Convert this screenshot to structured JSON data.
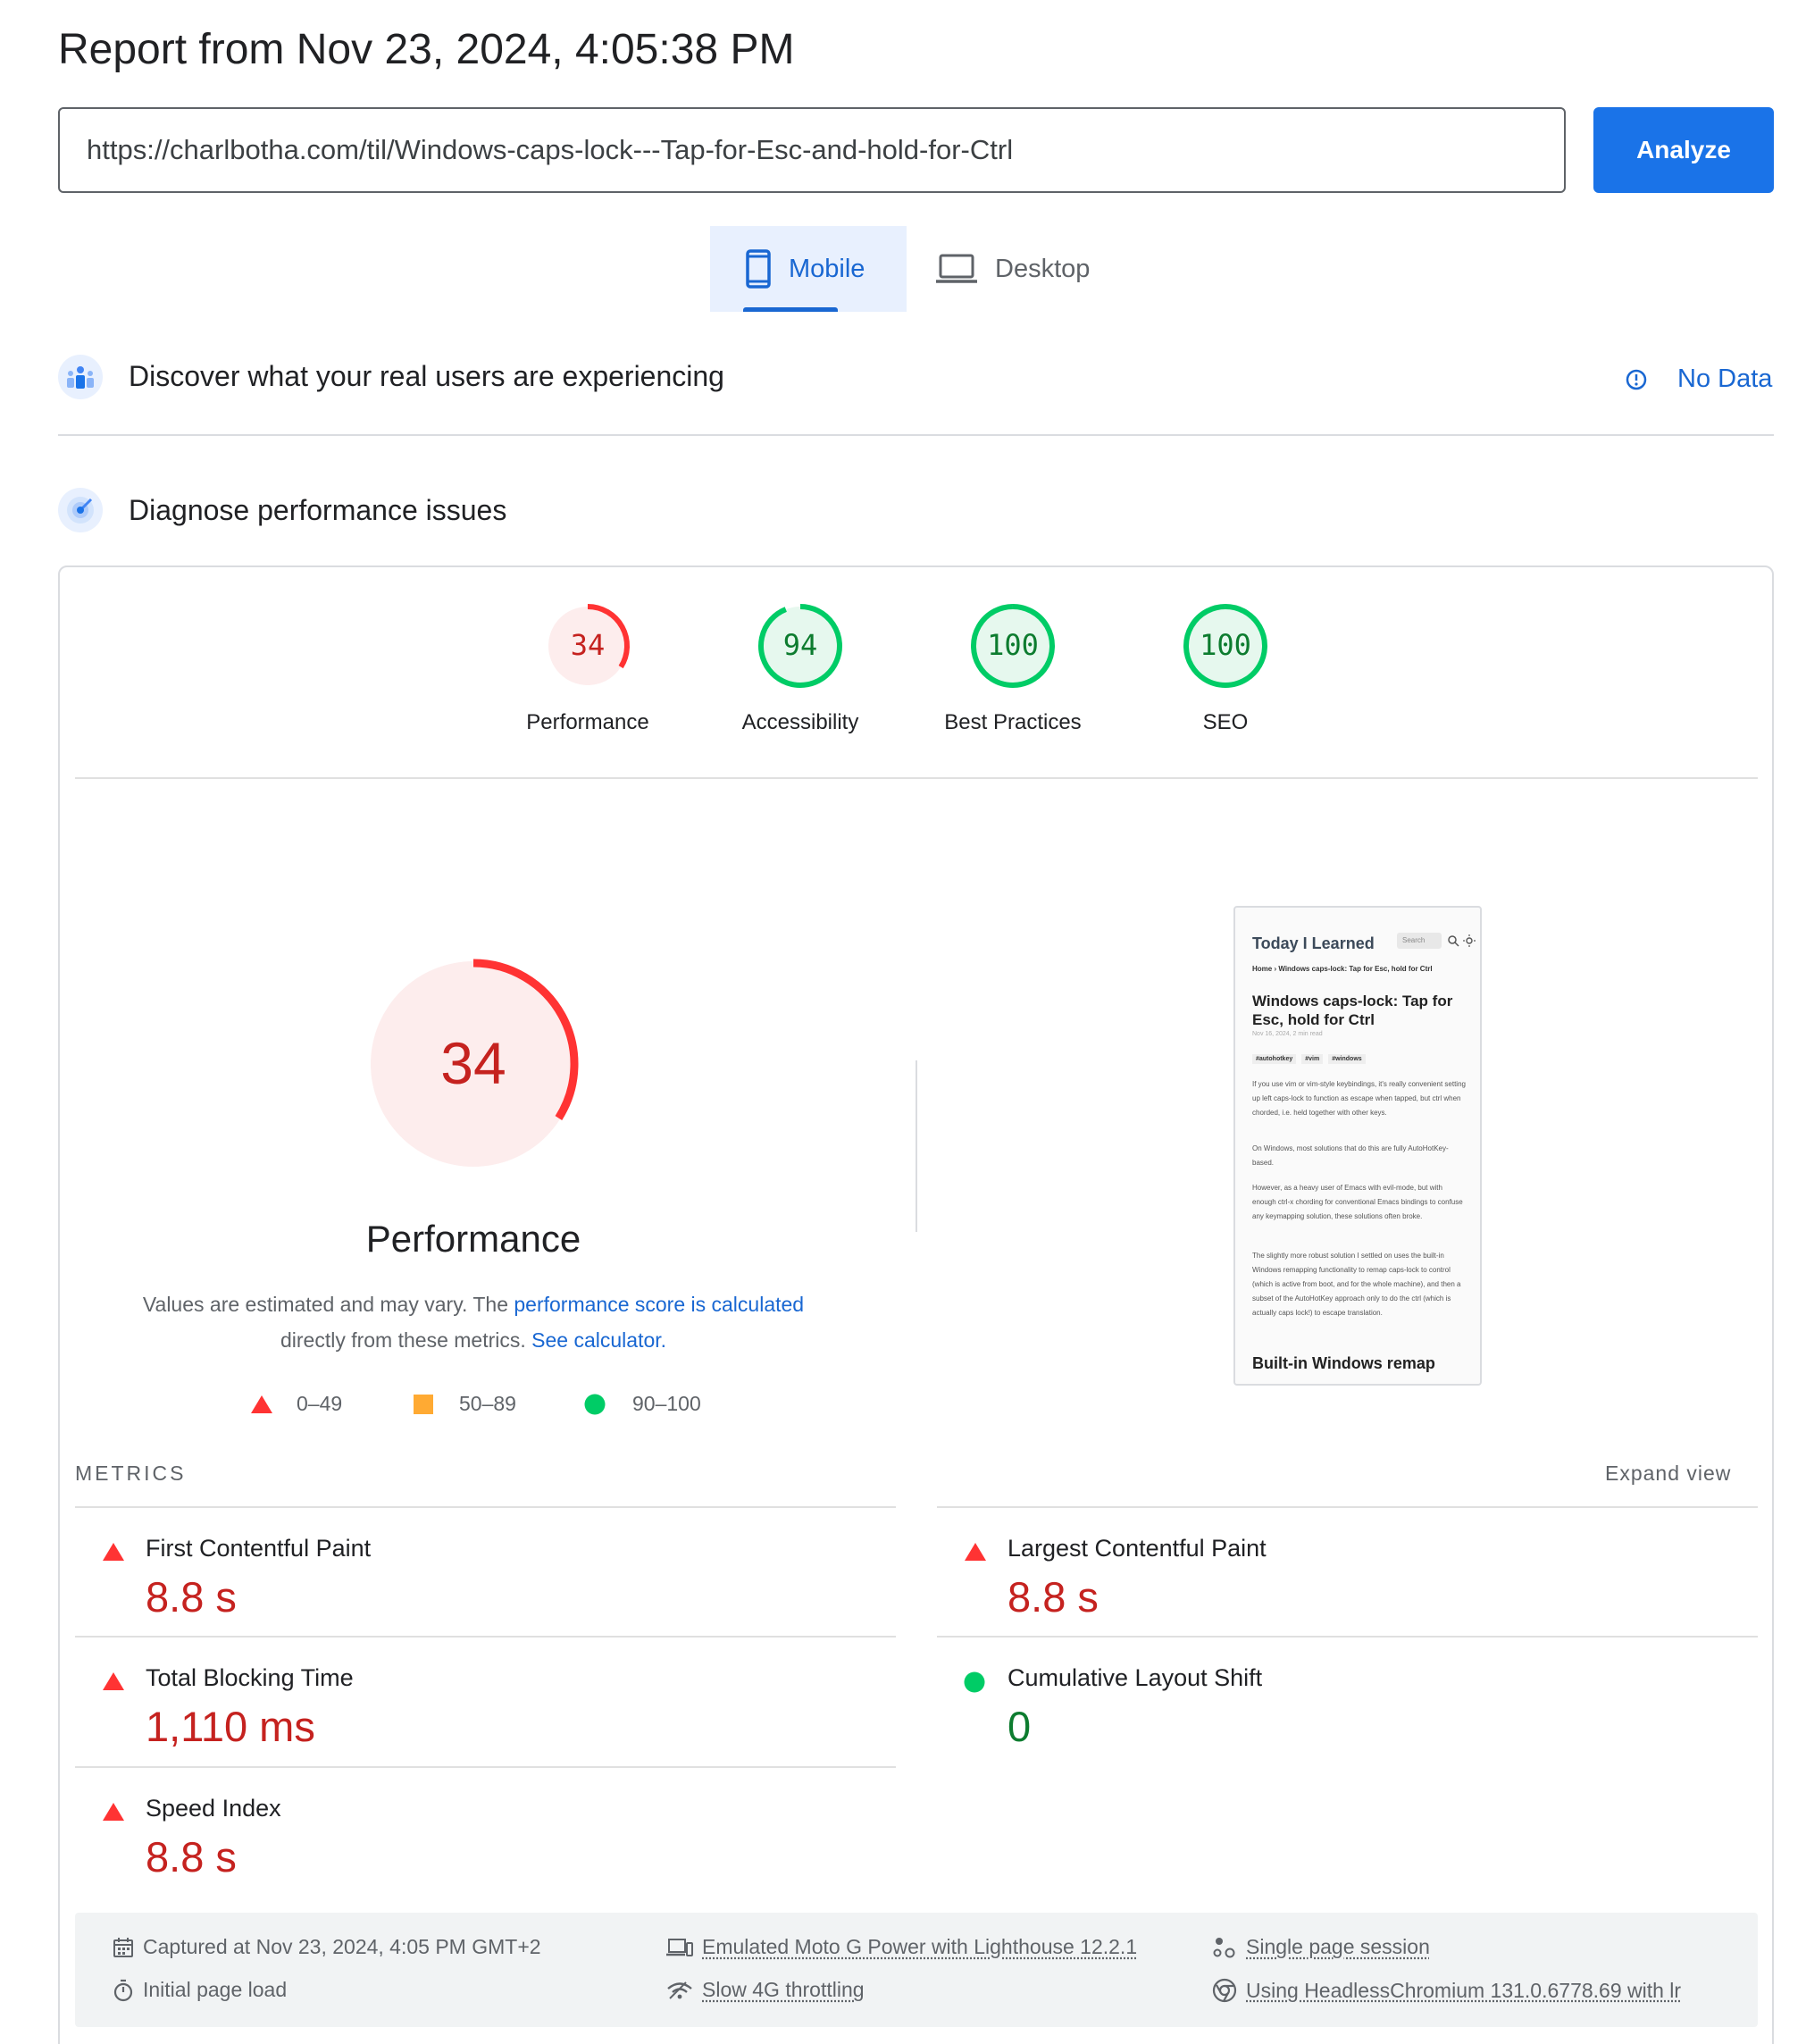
{
  "page": {
    "title": "Report from Nov 23, 2024, 4:05:38 PM"
  },
  "search": {
    "url": "https://charlbotha.com/til/Windows-caps-lock---Tap-for-Esc-and-hold-for-Ctrl",
    "analyze_label": "Analyze"
  },
  "tabs": [
    {
      "label": "Mobile",
      "active": true,
      "icon": "smartphone-icon"
    },
    {
      "label": "Desktop",
      "active": false,
      "icon": "laptop-icon"
    }
  ],
  "field_data": {
    "heading": "Discover what your real users are experiencing",
    "status": "No Data",
    "icon": "crux-users-icon"
  },
  "lab_data": {
    "heading": "Diagnose performance issues",
    "icon": "lighthouse-radar-icon"
  },
  "scores": [
    {
      "label": "Performance",
      "score": 34,
      "color": "#c5221f",
      "bg": "#fdeded",
      "arc": "#f33"
    },
    {
      "label": "Accessibility",
      "score": 94,
      "color": "#0d7c2f",
      "bg": "#e6f8ee",
      "arc": "#0c6"
    },
    {
      "label": "Best Practices",
      "score": 100,
      "color": "#0d7c2f",
      "bg": "#e6f8ee",
      "arc": "#0c6"
    },
    {
      "label": "SEO",
      "score": 100,
      "color": "#0d7c2f",
      "bg": "#e6f8ee",
      "arc": "#0c6"
    }
  ],
  "performance": {
    "score": 34,
    "title": "Performance",
    "desc_prefix": "Values are estimated and may vary. The ",
    "desc_link": "performance score is calculated",
    "desc_middle": "directly from these metrics. ",
    "desc_link2": "See calculator."
  },
  "legend": [
    {
      "label": "0–49",
      "shape": "triangle",
      "color": "#f33"
    },
    {
      "label": "50–89",
      "shape": "square",
      "color": "#fa3"
    },
    {
      "label": "90–100",
      "shape": "circle",
      "color": "#0c6"
    }
  ],
  "screenshot": {
    "site_title": "Today I Learned",
    "search_placeholder": "Search",
    "breadcrumb": "Home  ›  Windows caps-lock: Tap for Esc, hold for Ctrl",
    "heading": "Windows caps-lock: Tap for Esc, hold for Ctrl",
    "meta": "Nov 16, 2024,  2 min read",
    "tags": [
      "#autohotkey",
      "#vim",
      "#windows"
    ],
    "paragraphs": [
      "If you use vim or vim-style keybindings, it's really convenient setting up left caps-lock to function as escape when tapped, but ctrl when chorded, i.e. held together with other keys.",
      "On Windows, most solutions that do this are fully AutoHotKey-based.",
      "However, as a heavy user of Emacs with evil-mode, but with enough ctrl-x chording for conventional Emacs bindings to confuse any keymapping solution, these solutions often broke.",
      "The slightly more robust solution I settled on uses the built-in Windows remapping functionality to remap caps-lock to control (which is active from boot, and for the whole machine), and then a subset of the AutoHotKey approach only to do the ctrl (which is actually caps lock!) to escape translation."
    ],
    "subheading": "Built-in Windows remap"
  },
  "metrics": {
    "header": "METRICS",
    "expand_label": "Expand view",
    "items": [
      {
        "label": "First Contentful Paint",
        "value": "8.8 s",
        "status": "fail"
      },
      {
        "label": "Largest Contentful Paint",
        "value": "8.8 s",
        "status": "fail"
      },
      {
        "label": "Total Blocking Time",
        "value": "1,110 ms",
        "status": "fail"
      },
      {
        "label": "Cumulative Layout Shift",
        "value": "0",
        "status": "pass"
      },
      {
        "label": "Speed Index",
        "value": "8.8 s",
        "status": "fail"
      }
    ]
  },
  "footer": {
    "captured": "Captured at Nov 23, 2024, 4:05 PM GMT+2",
    "emulated": "Emulated Moto G Power with Lighthouse 12.2.1",
    "session": "Single page session",
    "load": "Initial page load",
    "throttling": "Slow 4G throttling",
    "browser": "Using HeadlessChromium 131.0.6778.69 with lr"
  }
}
